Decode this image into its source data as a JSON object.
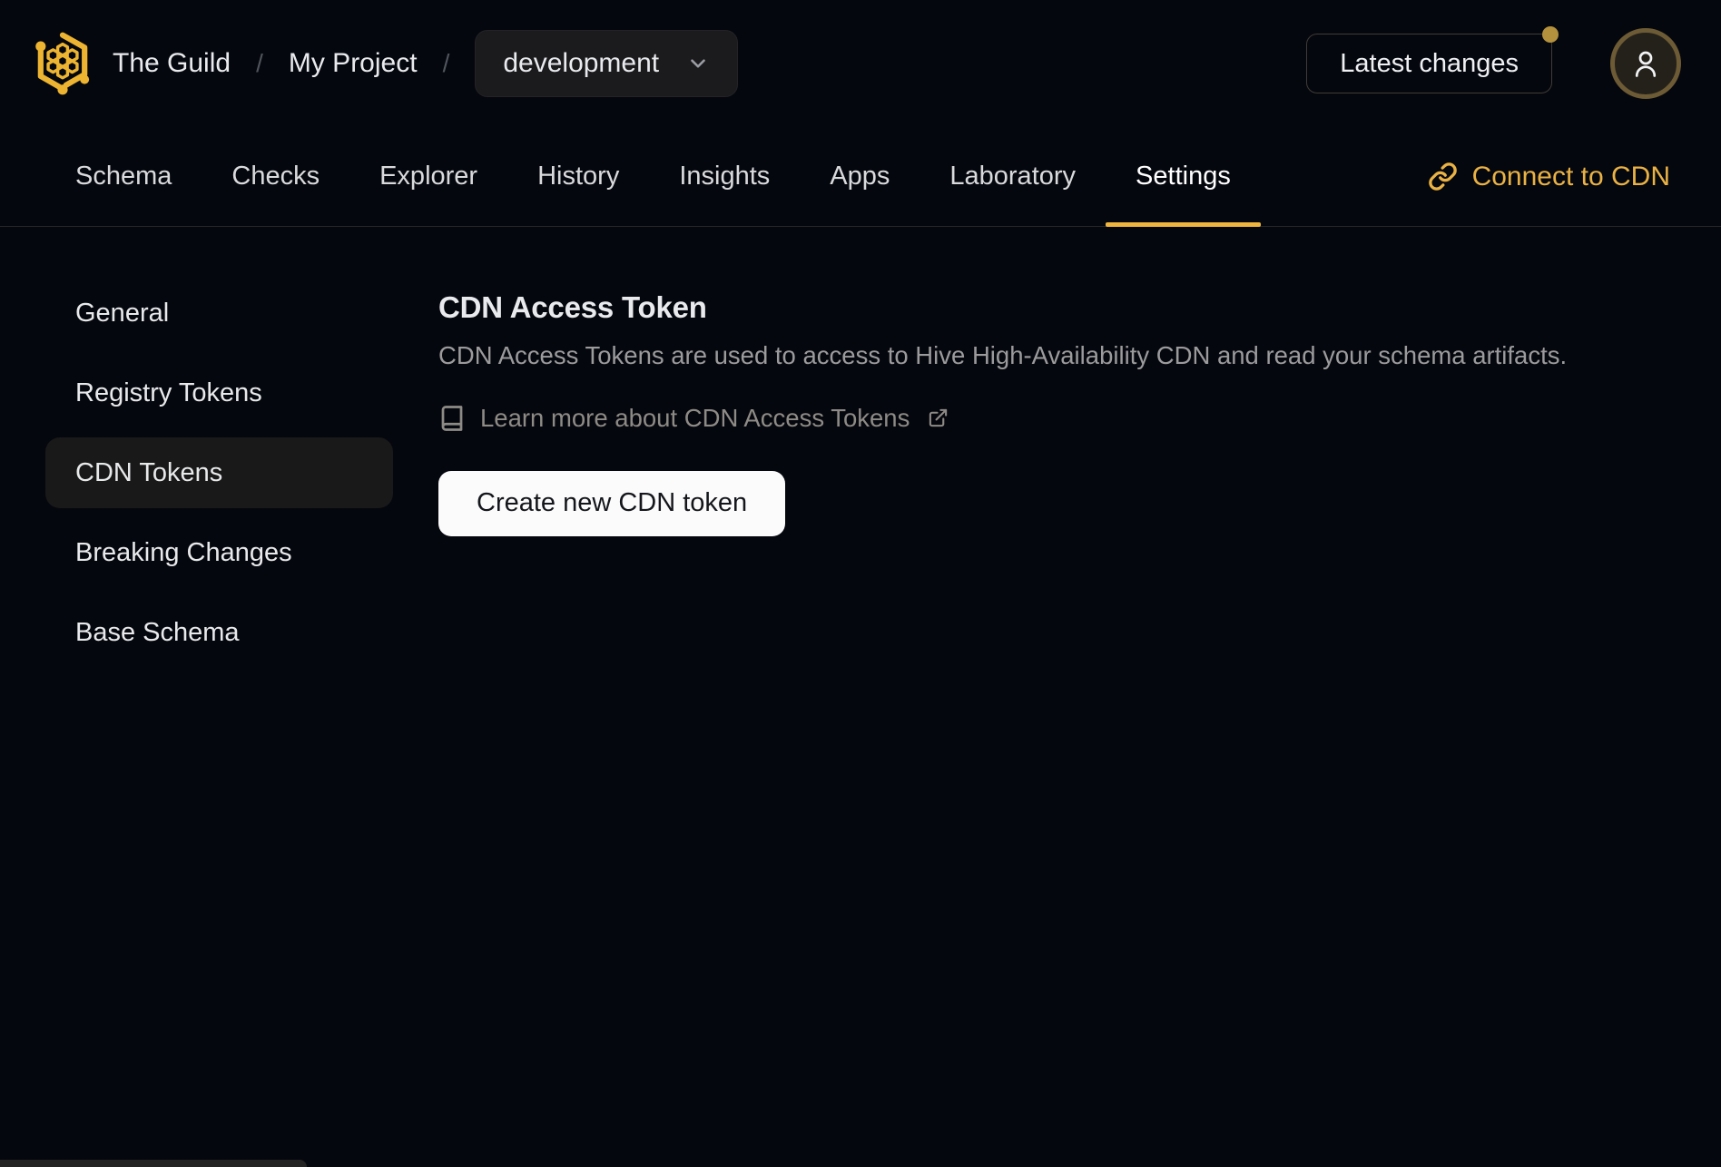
{
  "theme": {
    "background": "#05070e",
    "accent_gold": "#f0b53e",
    "link_gold": "#eab244",
    "surface": "#1b1b1d",
    "sidebar_active_bg": "#191919",
    "muted_text": "#9b9b9c",
    "button_bg": "#fbfbfb"
  },
  "header": {
    "logo_icon": "hive-logo",
    "breadcrumb": [
      {
        "label": "The Guild"
      },
      {
        "label": "My Project"
      }
    ],
    "separator": "/",
    "target_selector": {
      "value": "development",
      "icon": "chevron-down-icon"
    },
    "latest_changes_label": "Latest changes",
    "notification_dot": true,
    "avatar_icon": "user-icon"
  },
  "tabs": {
    "items": [
      {
        "label": "Schema",
        "active": false
      },
      {
        "label": "Checks",
        "active": false
      },
      {
        "label": "Explorer",
        "active": false
      },
      {
        "label": "History",
        "active": false
      },
      {
        "label": "Insights",
        "active": false
      },
      {
        "label": "Apps",
        "active": false
      },
      {
        "label": "Laboratory",
        "active": false
      },
      {
        "label": "Settings",
        "active": true
      }
    ],
    "connect_cdn": {
      "label": "Connect to CDN",
      "icon": "chain-link-icon"
    }
  },
  "sidebar": {
    "items": [
      {
        "label": "General",
        "active": false
      },
      {
        "label": "Registry Tokens",
        "active": false
      },
      {
        "label": "CDN Tokens",
        "active": true
      },
      {
        "label": "Breaking Changes",
        "active": false
      },
      {
        "label": "Base Schema",
        "active": false
      }
    ]
  },
  "main": {
    "title": "CDN Access Token",
    "description": "CDN Access Tokens are used to access to Hive High-Availability CDN and read your schema artifacts.",
    "learn_more": {
      "label": "Learn more about CDN Access Tokens",
      "leading_icon": "book-icon",
      "trailing_icon": "external-link-icon"
    },
    "create_button_label": "Create new CDN token"
  }
}
